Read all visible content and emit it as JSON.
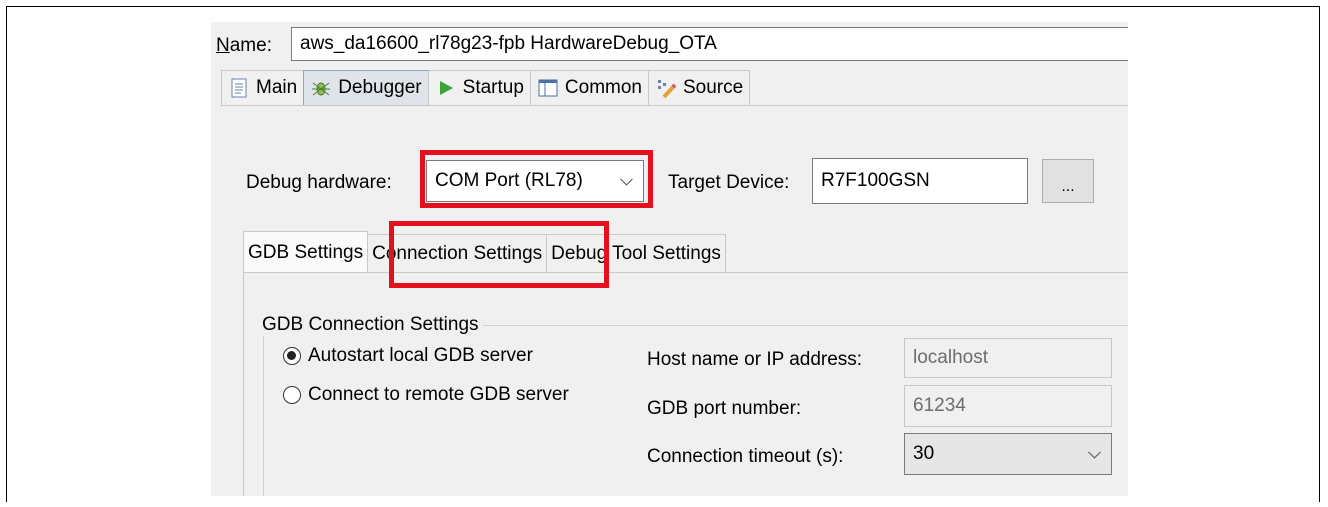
{
  "name": {
    "label_prefix": "N",
    "label_rest": "ame:",
    "value": "aws_da16600_rl78g23-fpb HardwareDebug_OTA"
  },
  "tabs": [
    {
      "label": "Main",
      "icon": "main-tab-icon"
    },
    {
      "label": "Debugger",
      "icon": "debugger-tab-icon"
    },
    {
      "label": "Startup",
      "icon": "startup-tab-icon"
    },
    {
      "label": "Common",
      "icon": "common-tab-icon"
    },
    {
      "label": "Source",
      "icon": "source-tab-icon"
    }
  ],
  "debugger": {
    "debug_hardware_label": "Debug hardware:",
    "debug_hardware_value": "COM Port (RL78)",
    "target_device_label": "Target Device:",
    "target_device_value": "R7F100GSN",
    "browse_label": "..."
  },
  "subtabs": [
    {
      "label": "GDB Settings"
    },
    {
      "label": "Connection Settings"
    },
    {
      "label": "Debug Tool Settings"
    }
  ],
  "gdb": {
    "group_title": "GDB Connection Settings",
    "radio_autostart": "Autostart local GDB server",
    "radio_remote": "Connect to remote GDB server",
    "host_label": "Host name or IP address:",
    "host_value": "localhost",
    "port_label": "GDB port number:",
    "port_value": "61234",
    "timeout_label": "Connection timeout (s):",
    "timeout_value": "30"
  },
  "colors": {
    "highlight": "#e5101d",
    "active_tab": "#dfe4ea"
  }
}
